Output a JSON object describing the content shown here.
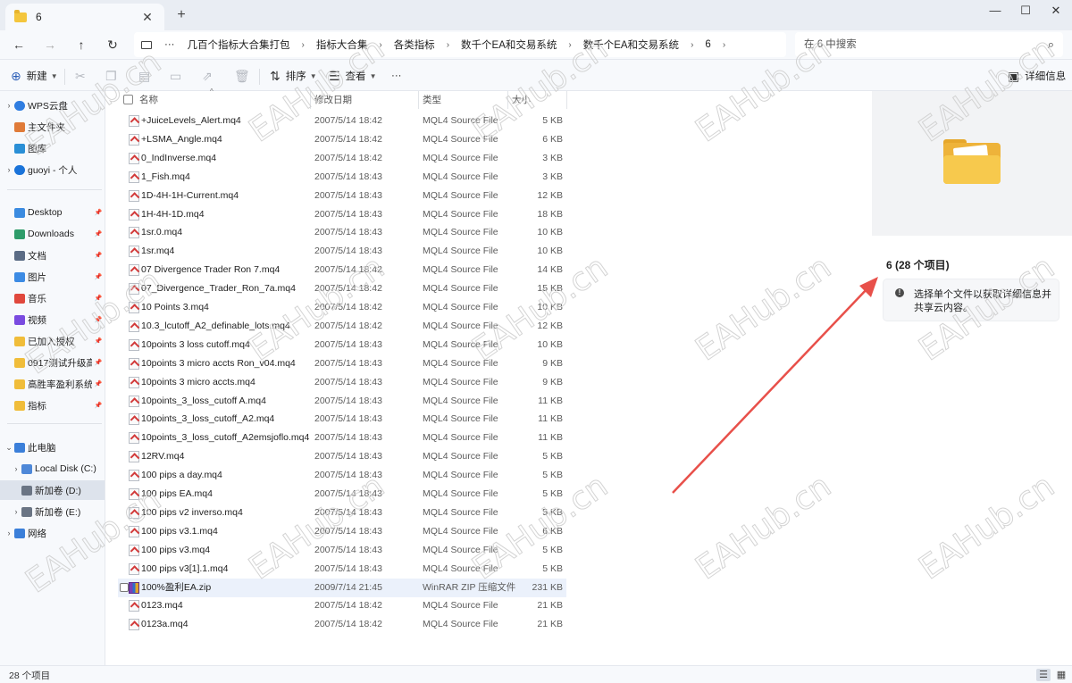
{
  "window": {
    "tab_title": "6",
    "tab_close": "✕",
    "new_tab": "+",
    "minimize": "—",
    "maximize": "☐",
    "close": "✕"
  },
  "nav": {
    "more": "···",
    "breadcrumbs": [
      "几百个指标大合集打包",
      "指标大合集",
      "各类指标",
      "数千个EA和交易系统",
      "数千个EA和交易系统",
      "6"
    ],
    "search_placeholder": "在 6 中搜索"
  },
  "toolbar": {
    "new_label": "新建",
    "sort_label": "排序",
    "view_label": "查看",
    "more": "···",
    "details_label": "详细信息"
  },
  "sidebar": {
    "items": [
      {
        "label": "WPS云盘",
        "icon": "cloud-icon",
        "color": "#2f7de1",
        "chevron": true
      },
      {
        "label": "主文件夹",
        "icon": "home-icon",
        "color": "#e07b39"
      },
      {
        "label": "图库",
        "icon": "gallery-icon",
        "color": "#2a8fd6"
      },
      {
        "label": "guoyi - 个人",
        "icon": "onedrive-icon",
        "color": "#1a73d9",
        "chevron": true
      },
      {
        "label": "Desktop",
        "icon": "desktop-icon",
        "color": "#3b8be0",
        "pin": true
      },
      {
        "label": "Downloads",
        "icon": "download-icon",
        "color": "#2e9c6a",
        "pin": true
      },
      {
        "label": "文档",
        "icon": "document-icon",
        "color": "#5a6b85",
        "pin": true
      },
      {
        "label": "图片",
        "icon": "pictures-icon",
        "color": "#3c8be4",
        "pin": true
      },
      {
        "label": "音乐",
        "icon": "music-icon",
        "color": "#e0483d",
        "pin": true
      },
      {
        "label": "视频",
        "icon": "video-icon",
        "color": "#7a4be0",
        "pin": true
      },
      {
        "label": "已加入授权",
        "icon": "folder-icon",
        "color": "#f0bd3a",
        "pin": true
      },
      {
        "label": "0917测试升级高",
        "icon": "folder-icon",
        "color": "#f0bd3a",
        "pin": true
      },
      {
        "label": "高胜率盈利系统",
        "icon": "folder-icon",
        "color": "#f0bd3a",
        "pin": true
      },
      {
        "label": "指标",
        "icon": "folder-icon",
        "color": "#f0bd3a",
        "pin": true
      },
      {
        "label": "此电脑",
        "icon": "pc-icon",
        "color": "#3b7fd9",
        "chevron": true
      },
      {
        "label": "Local Disk (C:)",
        "icon": "drive-icon",
        "color": "#4e88d8",
        "chevron": true
      },
      {
        "label": "新加卷 (D:)",
        "icon": "drive-icon",
        "color": "#6b7584",
        "selected": true
      },
      {
        "label": "新加卷 (E:)",
        "icon": "drive-icon",
        "color": "#6b7584",
        "chevron": true
      },
      {
        "label": "网络",
        "icon": "network-icon",
        "color": "#3b7fd9",
        "chevron": true
      }
    ]
  },
  "columns": {
    "name": "名称",
    "date": "修改日期",
    "type": "类型",
    "size": "大小"
  },
  "files": [
    {
      "name": "+JuiceLevels_Alert.mq4",
      "date": "2007/5/14 18:42",
      "type": "MQL4 Source File",
      "size": "5 KB"
    },
    {
      "name": "+LSMA_Angle.mq4",
      "date": "2007/5/14 18:42",
      "type": "MQL4 Source File",
      "size": "6 KB"
    },
    {
      "name": "0_IndInverse.mq4",
      "date": "2007/5/14 18:42",
      "type": "MQL4 Source File",
      "size": "3 KB"
    },
    {
      "name": "1_Fish.mq4",
      "date": "2007/5/14 18:43",
      "type": "MQL4 Source File",
      "size": "3 KB"
    },
    {
      "name": "1D-4H-1H-Current.mq4",
      "date": "2007/5/14 18:43",
      "type": "MQL4 Source File",
      "size": "12 KB"
    },
    {
      "name": "1H-4H-1D.mq4",
      "date": "2007/5/14 18:43",
      "type": "MQL4 Source File",
      "size": "18 KB"
    },
    {
      "name": "1sr.0.mq4",
      "date": "2007/5/14 18:43",
      "type": "MQL4 Source File",
      "size": "10 KB"
    },
    {
      "name": "1sr.mq4",
      "date": "2007/5/14 18:43",
      "type": "MQL4 Source File",
      "size": "10 KB"
    },
    {
      "name": "07 Divergence Trader Ron 7.mq4",
      "date": "2007/5/14 18:42",
      "type": "MQL4 Source File",
      "size": "14 KB"
    },
    {
      "name": "07_Divergence_Trader_Ron_7a.mq4",
      "date": "2007/5/14 18:42",
      "type": "MQL4 Source File",
      "size": "15 KB"
    },
    {
      "name": "10 Points 3.mq4",
      "date": "2007/5/14 18:42",
      "type": "MQL4 Source File",
      "size": "10 KB"
    },
    {
      "name": "10.3_lcutoff_A2_definable_lots.mq4",
      "date": "2007/5/14 18:42",
      "type": "MQL4 Source File",
      "size": "12 KB"
    },
    {
      "name": "10points 3 loss cutoff.mq4",
      "date": "2007/5/14 18:43",
      "type": "MQL4 Source File",
      "size": "10 KB"
    },
    {
      "name": "10points 3 micro accts Ron_v04.mq4",
      "date": "2007/5/14 18:43",
      "type": "MQL4 Source File",
      "size": "9 KB"
    },
    {
      "name": "10points 3 micro accts.mq4",
      "date": "2007/5/14 18:43",
      "type": "MQL4 Source File",
      "size": "9 KB"
    },
    {
      "name": "10points_3_loss_cutoff A.mq4",
      "date": "2007/5/14 18:43",
      "type": "MQL4 Source File",
      "size": "11 KB"
    },
    {
      "name": "10points_3_loss_cutoff_A2.mq4",
      "date": "2007/5/14 18:43",
      "type": "MQL4 Source File",
      "size": "11 KB"
    },
    {
      "name": "10points_3_loss_cutoff_A2emsjoflo.mq4",
      "date": "2007/5/14 18:43",
      "type": "MQL4 Source File",
      "size": "11 KB"
    },
    {
      "name": "12RV.mq4",
      "date": "2007/5/14 18:43",
      "type": "MQL4 Source File",
      "size": "5 KB"
    },
    {
      "name": "100 pips a day.mq4",
      "date": "2007/5/14 18:43",
      "type": "MQL4 Source File",
      "size": "5 KB"
    },
    {
      "name": "100 pips EA.mq4",
      "date": "2007/5/14 18:43",
      "type": "MQL4 Source File",
      "size": "5 KB"
    },
    {
      "name": "100 pips v2 inverso.mq4",
      "date": "2007/5/14 18:43",
      "type": "MQL4 Source File",
      "size": "5 KB"
    },
    {
      "name": "100 pips v3.1.mq4",
      "date": "2007/5/14 18:43",
      "type": "MQL4 Source File",
      "size": "6 KB"
    },
    {
      "name": "100 pips v3.mq4",
      "date": "2007/5/14 18:43",
      "type": "MQL4 Source File",
      "size": "5 KB"
    },
    {
      "name": "100 pips v3[1].1.mq4",
      "date": "2007/5/14 18:43",
      "type": "MQL4 Source File",
      "size": "5 KB"
    },
    {
      "name": "100%盈利EA.zip",
      "date": "2009/7/14 21:45",
      "type": "WinRAR ZIP 压缩文件",
      "size": "231 KB",
      "zip": true,
      "hover": true
    },
    {
      "name": "0123.mq4",
      "date": "2007/5/14 18:42",
      "type": "MQL4 Source File",
      "size": "21 KB"
    },
    {
      "name": "0123a.mq4",
      "date": "2007/5/14 18:42",
      "type": "MQL4 Source File",
      "size": "21 KB"
    }
  ],
  "details": {
    "title": "6 (28 个项目)",
    "info": "选择单个文件以获取详细信息并共享云内容。"
  },
  "status": {
    "item_count": "28 个项目"
  },
  "watermark": {
    "text": "EAHub.cn",
    "color": "#d0d0d0"
  },
  "annotation": {
    "arrow_color": "#e8504a"
  }
}
